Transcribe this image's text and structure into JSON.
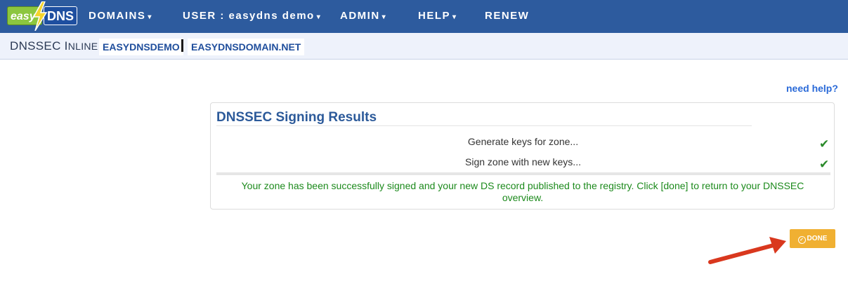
{
  "logo": {
    "part1": "easy",
    "part2": "DNS"
  },
  "nav": [
    {
      "label": "DOMAINS",
      "caret": "▾"
    },
    {
      "label": "USER : easydns demo",
      "caret": "▾"
    },
    {
      "label": "ADMIN",
      "caret": "▾"
    },
    {
      "label": "HELP",
      "caret": "▾"
    },
    {
      "label": "RENEW"
    }
  ],
  "subbar": {
    "title_main": "DNSSEC I",
    "title_small": "NLINE",
    "crumbs": [
      "EASYDNSDEMO",
      "EASYDNSDOMAIN.NET"
    ]
  },
  "help_link": "need help?",
  "panel": {
    "title": "DNSSEC Signing Results",
    "steps": [
      {
        "label": "Generate keys for zone...",
        "status": "✔"
      },
      {
        "label": "Sign zone with new keys...",
        "status": "✔"
      }
    ],
    "success_message": "Your zone has been successfully signed and your new DS record published to the registry. Click [done] to return to your DNSSEC overview."
  },
  "done_button": {
    "label": "DONE",
    "icon": "✓"
  },
  "colors": {
    "navbar": "#2d5b9e",
    "subbar": "#eef2fb",
    "accent_link": "#2a6ad8",
    "success": "#1c8a1c",
    "done_button": "#f0b032",
    "annotation_arrow": "#d9381e"
  }
}
